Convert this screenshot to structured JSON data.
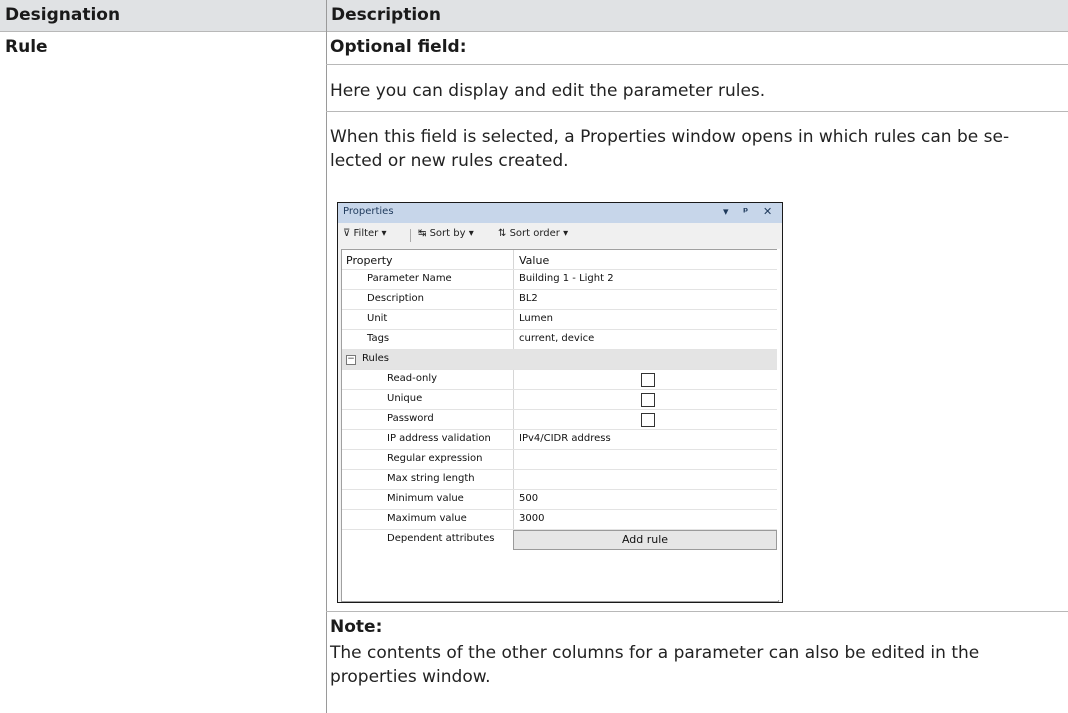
{
  "header": {
    "col1": "Designation",
    "col2": "Description"
  },
  "row": {
    "designation": "Rule",
    "optional_label": "Optional field:",
    "para1": "Here you can display and edit the parameter rules.",
    "para2": "When this field is selected, a Properties window opens in which rules can be se-lected or new rules created.",
    "note_label": "Note:",
    "note_text": "The contents of the other columns for a parameter can also be edited in the properties window."
  },
  "properties_window": {
    "title": "Properties",
    "title_controls": [
      "▾",
      "ᵖ",
      "✕"
    ],
    "toolbar": {
      "filter": "Filter",
      "sort_by": "Sort by",
      "sort_order": "Sort order"
    },
    "columns": {
      "property": "Property",
      "value": "Value"
    },
    "rows": [
      {
        "key": "Parameter Name",
        "value": "Building 1 - Light 2"
      },
      {
        "key": "Description",
        "value": "BL2"
      },
      {
        "key": "Unit",
        "value": "Lumen"
      },
      {
        "key": "Tags",
        "value": "current, device"
      }
    ],
    "rules_group": "Rules",
    "rules": [
      {
        "key": "Read-only",
        "value": "",
        "checkbox": true
      },
      {
        "key": "Unique",
        "value": "",
        "checkbox": true
      },
      {
        "key": "Password",
        "value": "",
        "checkbox": true
      },
      {
        "key": "IP address validation",
        "value": "IPv4/CIDR address"
      },
      {
        "key": "Regular expression",
        "value": ""
      },
      {
        "key": "Max string length",
        "value": ""
      },
      {
        "key": "Minimum value",
        "value": "500"
      },
      {
        "key": "Maximum value",
        "value": "3000"
      }
    ],
    "dependent": {
      "key": "Dependent attributes",
      "button": "Add rule"
    }
  }
}
